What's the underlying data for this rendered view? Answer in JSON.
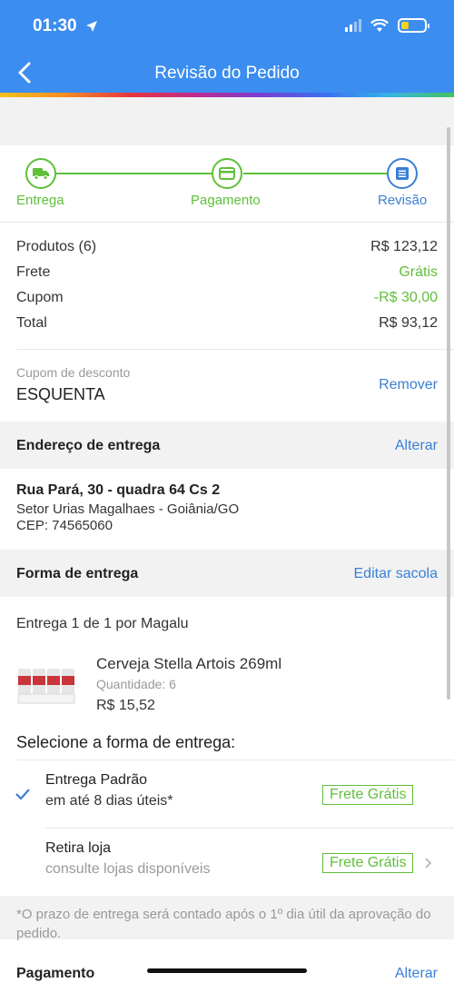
{
  "status": {
    "time": "01:30"
  },
  "nav": {
    "title": "Revisão do Pedido"
  },
  "steps": [
    {
      "label": "Entrega"
    },
    {
      "label": "Pagamento"
    },
    {
      "label": "Revisão"
    }
  ],
  "summary": {
    "products_label": "Produtos (6)",
    "products_value": "R$ 123,12",
    "shipping_label": "Frete",
    "shipping_value": "Grátis",
    "coupon_label": "Cupom",
    "coupon_value": "-R$ 30,00",
    "total_label": "Total",
    "total_value": "R$ 93,12"
  },
  "coupon": {
    "label": "Cupom de desconto",
    "code": "ESQUENTA",
    "remove": "Remover"
  },
  "address": {
    "title": "Endereço de entrega",
    "action": "Alterar",
    "line1": "Rua Pará, 30 - quadra 64 Cs 2",
    "line2": "Setor Urias Magalhaes - Goiânia/GO",
    "line3": "CEP: 74565060"
  },
  "delivery": {
    "title": "Forma de entrega",
    "action": "Editar sacola",
    "shipment_bold": "Entrega 1 de 1",
    "shipment_by": " por Magalu",
    "product_name": "Cerveja Stella Artois 269ml",
    "product_qty": "Quantidade: 6",
    "product_price": "R$ 15,52",
    "select_title": "Selecione a forma de entrega:",
    "options": [
      {
        "title": "Entrega Padrão",
        "subtitle": "em até 8 dias úteis*",
        "badge": "Frete Grátis"
      },
      {
        "title": "Retira loja",
        "subtitle": "consulte lojas disponíveis",
        "badge": "Frete Grátis"
      }
    ],
    "note": "*O prazo de entrega será contado após o 1º dia útil da aprovação do pedido."
  },
  "payment": {
    "title": "Pagamento",
    "action": "Alterar"
  },
  "colors": {
    "primary": "#3b8df0",
    "green": "#5fbf3a",
    "link": "#3a7fd5"
  },
  "icons": {
    "back": "chevron-left-icon",
    "truck": "truck-icon",
    "card": "credit-card-icon",
    "review": "list-icon",
    "check": "check-icon",
    "chevron": "chevron-right-icon"
  }
}
